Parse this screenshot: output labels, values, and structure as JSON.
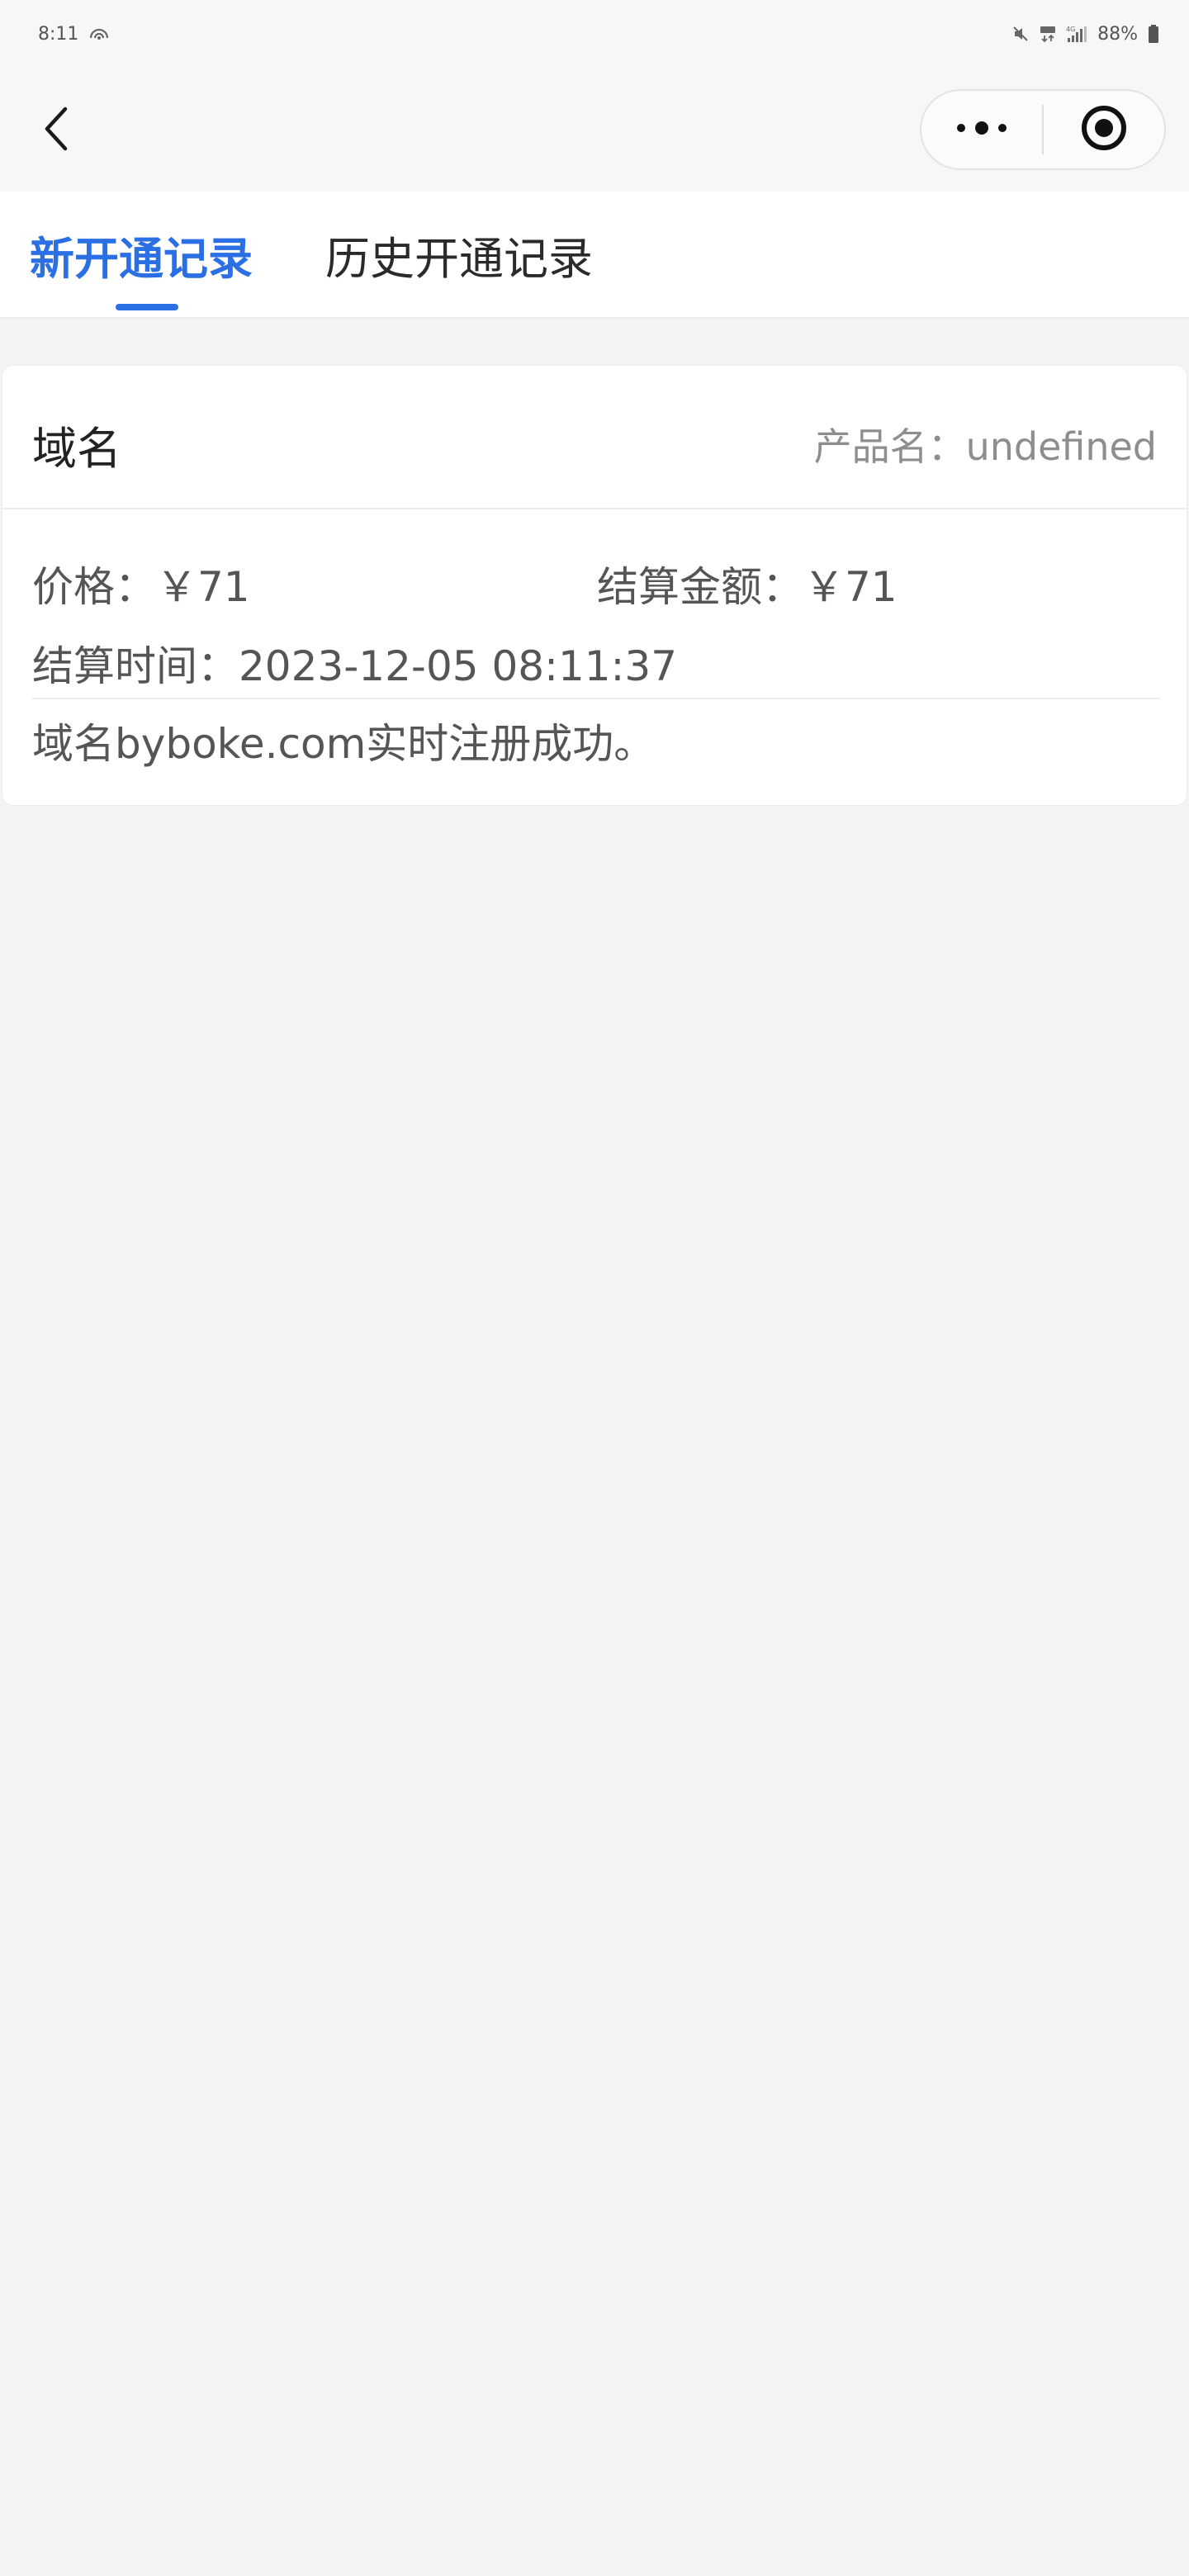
{
  "status_bar": {
    "time": "8:11",
    "battery": "88%",
    "network": "4G"
  },
  "tabs": [
    {
      "label": "新开通记录",
      "active": true
    },
    {
      "label": "历史开通记录",
      "active": false
    }
  ],
  "card": {
    "title": "域名",
    "product_name": "产品名：undefined",
    "price": "价格：￥71",
    "settle_amount": "结算金额：￥71",
    "settle_time": "结算时间：2023-12-05 08:11:37",
    "message": "域名byboke.com实时注册成功。"
  },
  "icons": {
    "back": "chevron-left-icon",
    "more": "more-dots-icon",
    "close": "target-circle-icon"
  },
  "colors": {
    "accent": "#2a6fe3",
    "background": "#f4f4f4"
  }
}
